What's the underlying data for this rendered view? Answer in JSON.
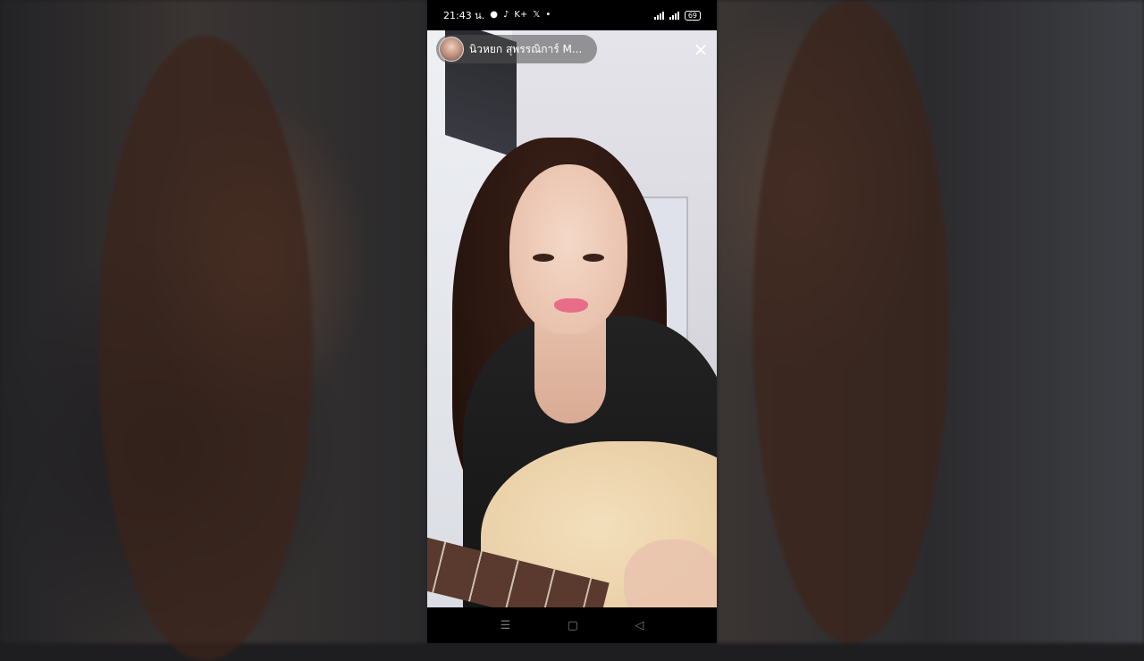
{
  "status_bar": {
    "time": "21:43 น.",
    "app_icons": [
      "line-icon",
      "tiktok-icon",
      "k-plus-icon",
      "x-icon",
      "dot-icon"
    ],
    "k_plus_label": "K+",
    "x_label": "𝕏",
    "battery": "69"
  },
  "story": {
    "profile_name": "นิวหยก สุพรรณิการ์ M...",
    "close_label": "✕"
  },
  "nav_bar": {
    "recents": "☰",
    "home": "▢",
    "back": "◁"
  },
  "colors": {
    "background": "#1e1e20",
    "phone": "#000000",
    "pill": "rgba(80,80,80,0.55)"
  }
}
